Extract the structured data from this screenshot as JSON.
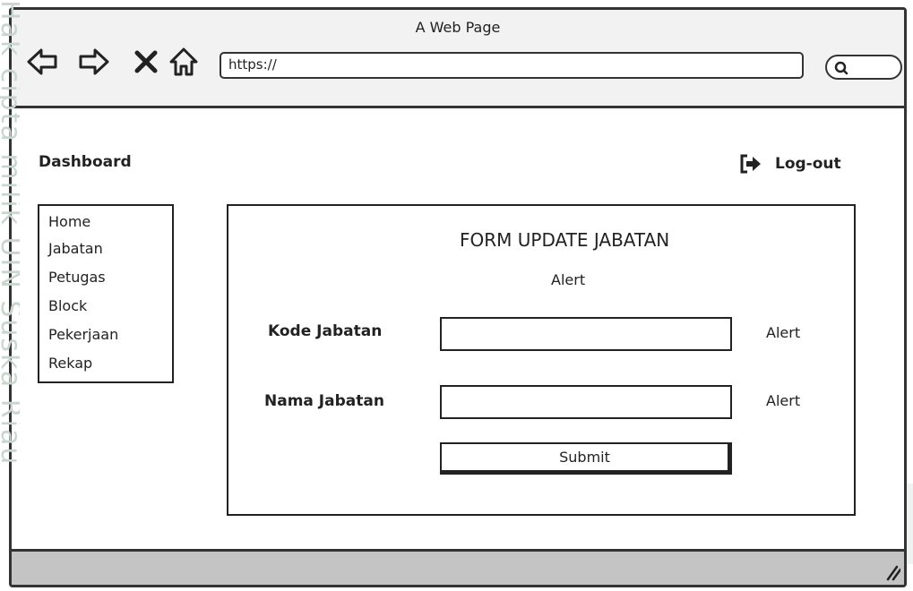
{
  "watermark": {
    "side_text": "Hak cipta milik UIN Suska Riau"
  },
  "browser": {
    "title": "A Web Page",
    "url": "https://",
    "icons": [
      "back-arrow-icon",
      "forward-arrow-icon",
      "close-x-icon",
      "home-icon",
      "search-icon"
    ]
  },
  "header": {
    "title": "Dashboard",
    "logout_label": "Log-out",
    "logout_icon": "logout-icon"
  },
  "sidebar": {
    "items": [
      {
        "label": "Home"
      },
      {
        "label": "Jabatan"
      },
      {
        "label": "Petugas"
      },
      {
        "label": "Block"
      },
      {
        "label": "Pekerjaan"
      },
      {
        "label": "Rekap"
      }
    ]
  },
  "form": {
    "title": "FORM UPDATE JABATAN",
    "alert": "Alert",
    "fields": [
      {
        "label": "Kode Jabatan",
        "value": "",
        "alert": "Alert"
      },
      {
        "label": "Nama Jabatan",
        "value": "",
        "alert": "Alert"
      }
    ],
    "submit_label": "Submit"
  },
  "colors": {
    "chrome": "#f2f2f2",
    "statusbar": "#c4c4c4",
    "stroke": "#333333",
    "watermark": "#c9d6d0"
  }
}
